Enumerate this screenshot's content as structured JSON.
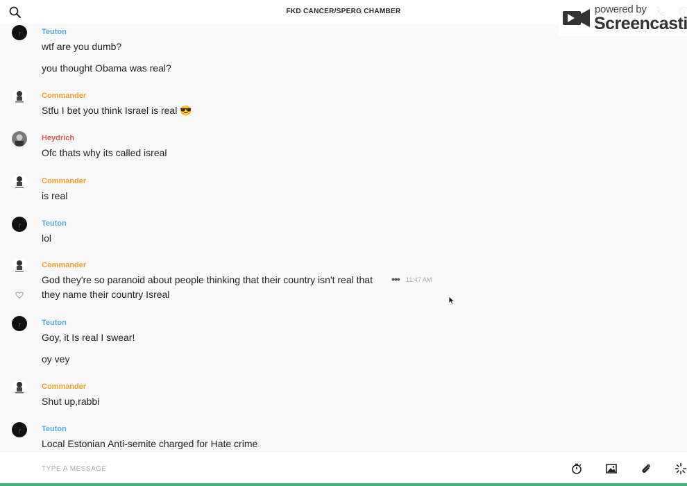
{
  "header": {
    "title": "FKD CANCER/SPERG CHAMBER",
    "search_icon": "search-icon",
    "phone_icon": "phone-icon",
    "info_icon": "info-icon"
  },
  "watermark": {
    "small": "powered by",
    "big": "Screencastify"
  },
  "messages": [
    {
      "author": "Teuton",
      "color": "#5aa9dc",
      "lines": [
        "wtf are you dumb?",
        "you thought Obama was real?"
      ]
    },
    {
      "author": "Commander",
      "color": "#f0a030",
      "lines": [
        "Stfu I bet you think Israel is real 😎"
      ]
    },
    {
      "author": "Heydrich",
      "color": "#e05a4f",
      "lines": [
        "Ofc thats why its called isreal"
      ]
    },
    {
      "author": "Commander",
      "color": "#f0a030",
      "lines": [
        "is real"
      ]
    },
    {
      "author": "Teuton",
      "color": "#5aa9dc",
      "lines": [
        "lol"
      ]
    },
    {
      "author": "Commander",
      "color": "#f0a030",
      "lines": [
        "God they're so paranoid about people thinking that their country isn't real that",
        "they name their country Isreal"
      ],
      "more": "•••",
      "time": "11:47 AM"
    },
    {
      "author": "Teuton",
      "color": "#5aa9dc",
      "lines": [
        "Goy, it Is real I swear!",
        "oy vey"
      ]
    },
    {
      "author": "Commander",
      "color": "#f0a030",
      "lines": [
        "Shut up,rabbi"
      ]
    },
    {
      "author": "Teuton",
      "color": "#5aa9dc",
      "lines": [
        "Local Estonian Anti-semite charged for Hate crime"
      ]
    }
  ],
  "composer": {
    "placeholder": "TYPE A MESSAGE",
    "value": "",
    "tools": [
      "stopwatch-icon",
      "image-icon",
      "paperclip-icon",
      "sparkle-icon"
    ]
  }
}
